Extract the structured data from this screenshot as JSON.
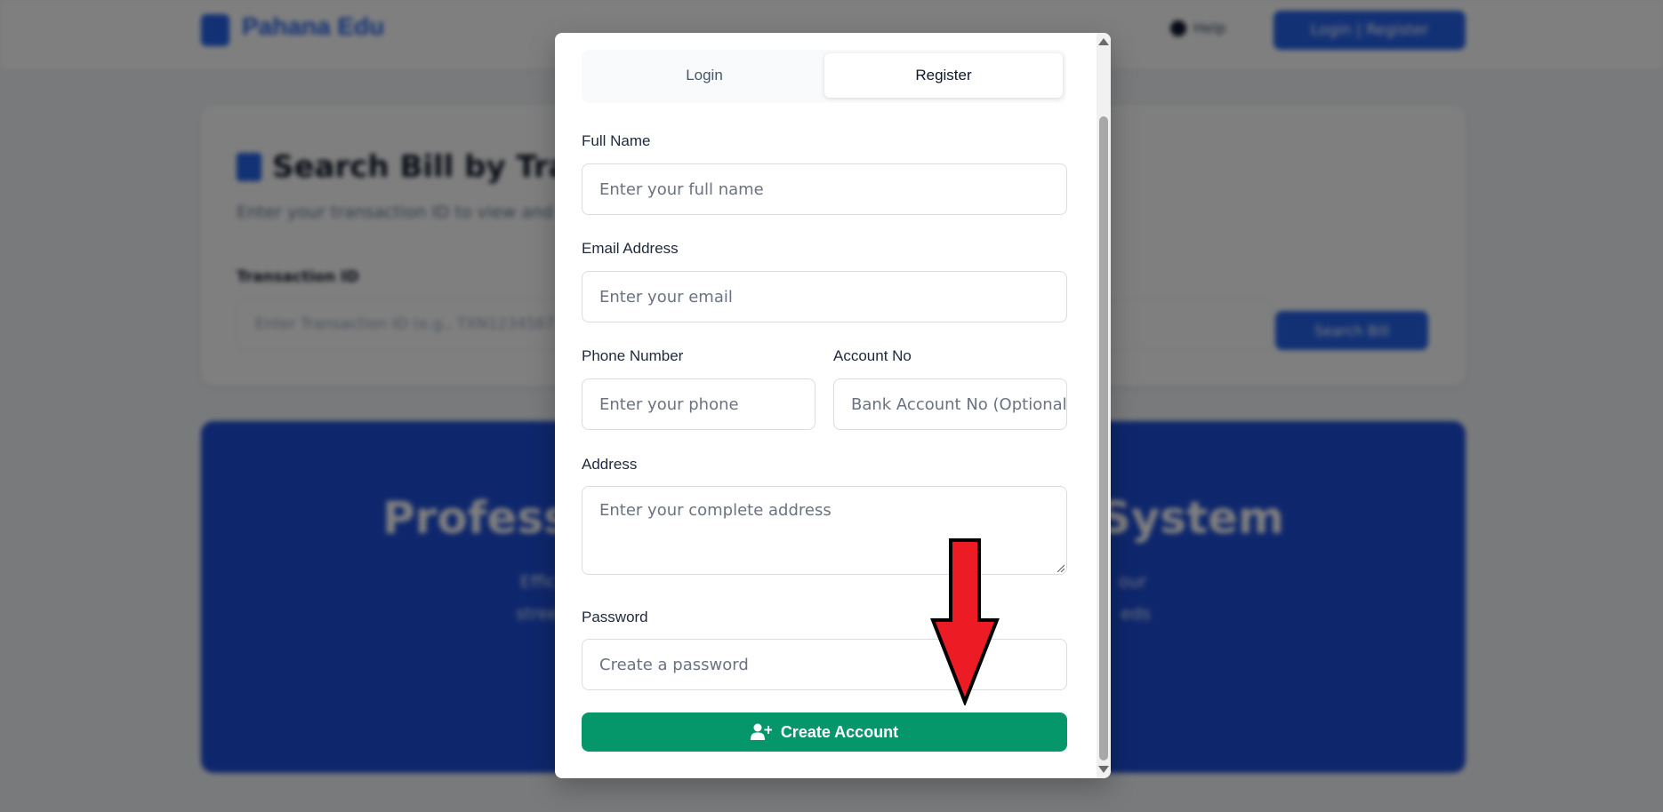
{
  "background": {
    "brand": {
      "name": "Pahana Edu"
    },
    "header": {
      "help_label": "Help",
      "auth_button_label": "Login | Register"
    },
    "search_card": {
      "title": "Search Bill by Tra",
      "subtitle": "Enter your transaction ID to view and",
      "field_label": "Transaction ID",
      "field_placeholder": "Enter Transaction ID (e.g., TXN1234567",
      "button_label": "Search Bill"
    },
    "hero": {
      "title_left": "Profess",
      "title_right": "System",
      "line1_left": "Effic",
      "line1_right": "our",
      "line2_left": "stree",
      "line2_right": "eds"
    }
  },
  "modal": {
    "tabs": [
      {
        "label": "Login",
        "active": false
      },
      {
        "label": "Register",
        "active": true
      }
    ],
    "fields": {
      "full_name": {
        "label": "Full Name",
        "placeholder": "Enter your full name"
      },
      "email": {
        "label": "Email Address",
        "placeholder": "Enter your email"
      },
      "phone": {
        "label": "Phone Number",
        "placeholder": "Enter your phone"
      },
      "account_no": {
        "label": "Account No",
        "placeholder": "Bank Account No (Optional)"
      },
      "address": {
        "label": "Address",
        "placeholder": "Enter your complete address"
      },
      "password": {
        "label": "Password",
        "placeholder": "Create a password"
      }
    },
    "submit_label": "Create Account",
    "submit_icon": "user-plus-icon"
  },
  "colors": {
    "primary": "#2563eb",
    "success": "#059669",
    "annotation_arrow": "#ed1c24"
  }
}
